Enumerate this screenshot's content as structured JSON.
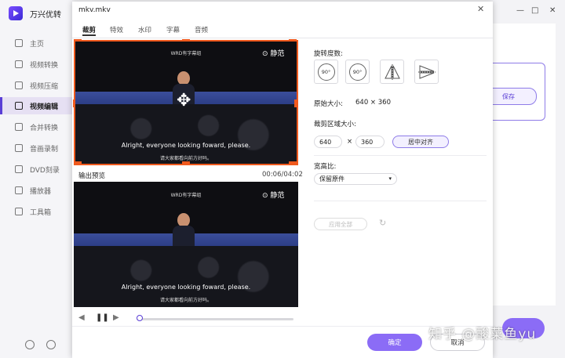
{
  "app": {
    "title": "万兴优转"
  },
  "sidebar": {
    "items": [
      {
        "label": "主页",
        "icon": "home-icon"
      },
      {
        "label": "视频转换",
        "icon": "convert-icon"
      },
      {
        "label": "视频压缩",
        "icon": "compress-icon"
      },
      {
        "label": "视频编辑",
        "icon": "scissors-icon",
        "active": true
      },
      {
        "label": "合并转换",
        "icon": "merge-icon"
      },
      {
        "label": "音画录制",
        "icon": "record-icon"
      },
      {
        "label": "DVD刻录",
        "icon": "disc-icon"
      },
      {
        "label": "播放器",
        "icon": "player-icon"
      },
      {
        "label": "工具箱",
        "icon": "toolbox-icon"
      }
    ]
  },
  "window": {
    "minimize": "—",
    "maximize": "□",
    "close": "✕"
  },
  "background": {
    "save_label": "保存"
  },
  "dialog": {
    "title": "mkv.mkv",
    "close": "✕",
    "tabs": [
      "裁剪",
      "特效",
      "水印",
      "字幕",
      "音频"
    ],
    "active_tab": "裁剪",
    "video": {
      "top_text": "WRD有字幕组",
      "logo_text": "静范",
      "caption_en": "Alright, everyone looking foward, please.",
      "caption_cn": "请大家都看向前方好吗。"
    },
    "preview_label": "输出预览",
    "time": "00:06/04:02",
    "progress": 0.02,
    "settings": {
      "rotate_label": "旋转度数:",
      "rot_left": "90°",
      "rot_right": "90°",
      "original_size_label": "原始大小:",
      "original_size_value": "640 × 360",
      "crop_area_label": "裁剪区域大小:",
      "crop_width": "640",
      "crop_x": "×",
      "crop_height": "360",
      "center_label": "居中对齐",
      "aspect_label": "宽高比:",
      "aspect_value": "保留原件",
      "apply_all_label": "应用全部"
    },
    "ok_label": "确定",
    "cancel_label": "取消"
  },
  "watermark": "知乎 @酸菜鱼yu",
  "colors": {
    "accent": "#8b6cf6",
    "crop_border": "#f05a1e",
    "active_nav_bg": "#e6e0f3"
  }
}
